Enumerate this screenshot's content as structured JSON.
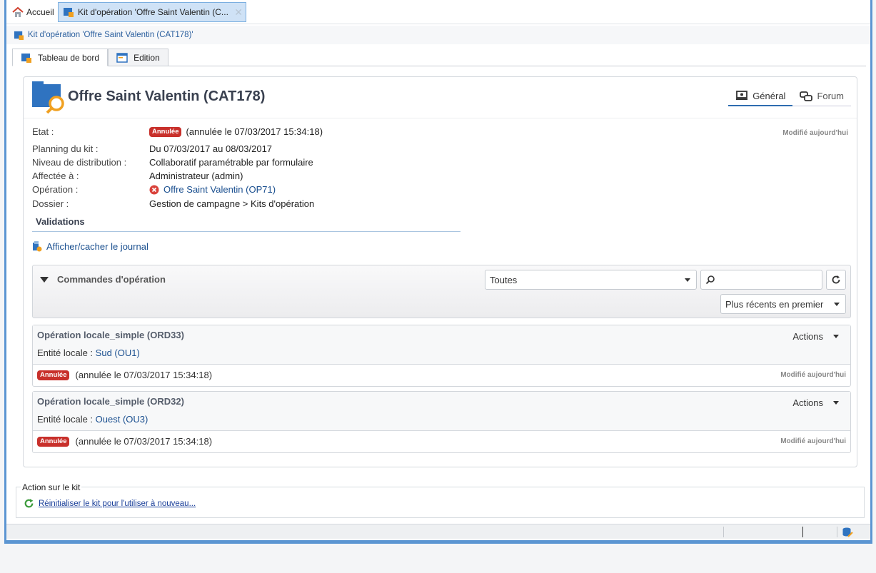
{
  "colors": {
    "accent": "#2e6db0",
    "cancel_badge": "#c8302b",
    "window_border": "#5b95d2"
  },
  "topbar": {
    "home_label": "Accueil",
    "doc_tab_label": "Kit d'opération 'Offre Saint Valentin (C..."
  },
  "breadcrumb": {
    "label": "Kit d'opération 'Offre Saint Valentin (CAT178)'"
  },
  "subtabs": {
    "dashboard": "Tableau de bord",
    "edition": "Edition"
  },
  "header": {
    "title": "Offre Saint Valentin (CAT178)",
    "tab_general": "Général",
    "tab_forum": "Forum"
  },
  "props": {
    "modified": "Modifié aujourd'hui",
    "rows": [
      {
        "label": "Etat :",
        "badge": "Annulée",
        "value": "(annulée le 07/03/2017 15:34:18)"
      },
      {
        "label": "Planning du kit :",
        "value": "Du 07/03/2017 au 08/03/2017"
      },
      {
        "label": "Niveau de distribution :",
        "value": "Collaboratif paramétrable par formulaire"
      },
      {
        "label": "Affectée à :",
        "value": "Administrateur (admin)"
      },
      {
        "label": "Opération :",
        "value": "Offre Saint Valentin (OP71)"
      },
      {
        "label": "Dossier :",
        "value": "Gestion de campagne > Kits d'opération"
      }
    ]
  },
  "validations": {
    "title": "Validations",
    "journal_link": "Afficher/cacher le journal"
  },
  "commands": {
    "title": "Commandes d'opération",
    "filter_value": "Toutes",
    "search_placeholder": "",
    "sort_value": "Plus récents en premier"
  },
  "orders": [
    {
      "name": "Opération locale_simple (ORD33)",
      "entity_label": "Entité locale :",
      "entity_value": "Sud (OU1)",
      "actions": "Actions",
      "badge": "Annulée",
      "status": "(annulée le 07/03/2017 15:34:18)",
      "modified": "Modifié aujourd'hui"
    },
    {
      "name": "Opération locale_simple (ORD32)",
      "entity_label": "Entité locale :",
      "entity_value": "Ouest (OU3)",
      "actions": "Actions",
      "badge": "Annulée",
      "status": "(annulée le 07/03/2017 15:34:18)",
      "modified": "Modifié aujourd'hui"
    }
  ],
  "kit_action": {
    "legend": "Action sur le kit",
    "link": "Réinitialiser le kit pour l'utiliser à nouveau..."
  }
}
